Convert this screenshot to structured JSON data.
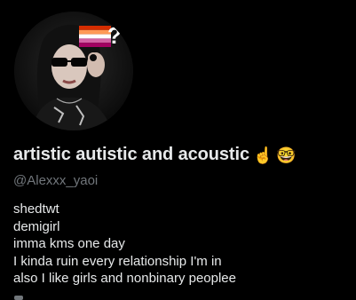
{
  "profile": {
    "display_name": "artistic autistic and acoustic",
    "name_emoji": [
      "☝️",
      "🤓"
    ],
    "handle": "@Alexxx_yaoi",
    "bio_lines": [
      "shedtwt",
      "demigirl",
      "imma kms one day",
      "I kinda ruin every relationship I'm in",
      "also I like girls and nonbinary peoplee"
    ]
  },
  "colors": {
    "background": "#000000",
    "primary_text": "#e7e9ea",
    "secondary_text": "#71767b",
    "flag_stripes": [
      "#d52d00",
      "#ff9a56",
      "#ffffff",
      "#d362a4",
      "#a30262"
    ]
  },
  "icons": {
    "avatar": "profile-photo",
    "flag": "lesbian-flag-icon",
    "question": "question-mark-icon"
  }
}
